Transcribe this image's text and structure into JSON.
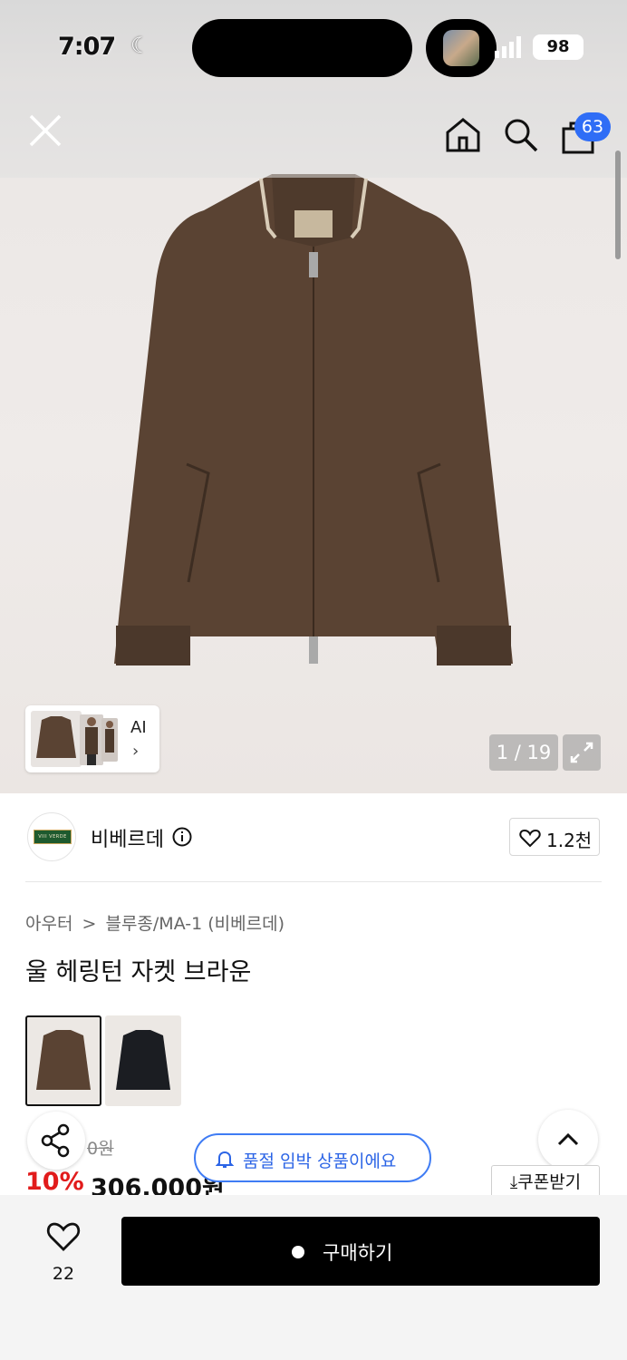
{
  "status_bar": {
    "time": "7:07",
    "battery": "98"
  },
  "nav": {
    "cart_count": "63"
  },
  "gallery": {
    "counter": "1 / 19",
    "ai_label": "AI"
  },
  "brand": {
    "name": "비베르데",
    "logo_text": "VIII VERDE",
    "likes": "1.2천"
  },
  "breadcrumb": {
    "category": "아우터",
    "separator": ">",
    "subcategory": "블루종/MA-1 (비베르데)"
  },
  "product": {
    "title": "울 헤링턴 자켓 브라운",
    "colors": [
      "brown",
      "black"
    ],
    "original_price": "0원",
    "discount": "10%",
    "price": "306,000원"
  },
  "toast": {
    "text": "품절 임박 상품이에요"
  },
  "coupon": {
    "label": "쿠폰받기"
  },
  "bottom": {
    "wish_count": "22",
    "buy_label": "구매하기"
  },
  "colors": {
    "accent_blue": "#2f6df6",
    "discount_red": "#e11b1b",
    "buy_black": "#000000"
  }
}
